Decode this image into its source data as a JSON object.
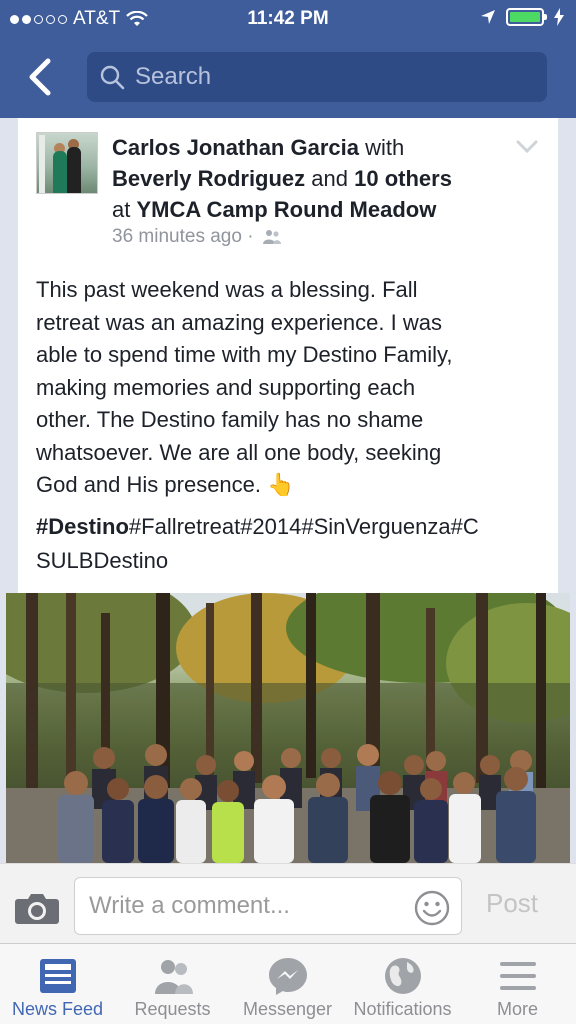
{
  "status_bar": {
    "carrier": "AT&T",
    "time": "11:42 PM"
  },
  "header": {
    "search_placeholder": "Search"
  },
  "post": {
    "author": "Carlos Jonathan Garcia",
    "with_word": "with",
    "tagged_person": "Beverly Rodriguez",
    "and_word": "and",
    "others": "10 others",
    "at_word": "at",
    "location": "YMCA Camp Round Meadow",
    "timestamp": "36 minutes ago ·",
    "body_lines": [
      "This past weekend was a blessing. Fall",
      "retreat was an amazing experience. I was",
      "able to spend time with my Destino Family,",
      "making memories and supporting each",
      "other. The Destino family has no shame",
      "whatsoever. We are all one body, seeking",
      "God and His presence. 👆"
    ],
    "hashtag_bold": "#Destino",
    "hashtag_rest": "#Fallretreat#2014#SinVerguenza#C",
    "hashtag_line2": "SULBDestino"
  },
  "comment_bar": {
    "placeholder": "Write a comment...",
    "post_label": "Post"
  },
  "tabs": [
    {
      "label": "News Feed",
      "icon": "news-feed-icon",
      "active": true
    },
    {
      "label": "Requests",
      "icon": "friend-requests-icon"
    },
    {
      "label": "Messenger",
      "icon": "messenger-icon"
    },
    {
      "label": "Notifications",
      "icon": "globe-icon"
    },
    {
      "label": "More",
      "icon": "menu-icon"
    }
  ],
  "colors": {
    "facebook_blue": "#3f5d9a",
    "search_field": "#2f4b85",
    "active_tab": "#4267b2"
  }
}
